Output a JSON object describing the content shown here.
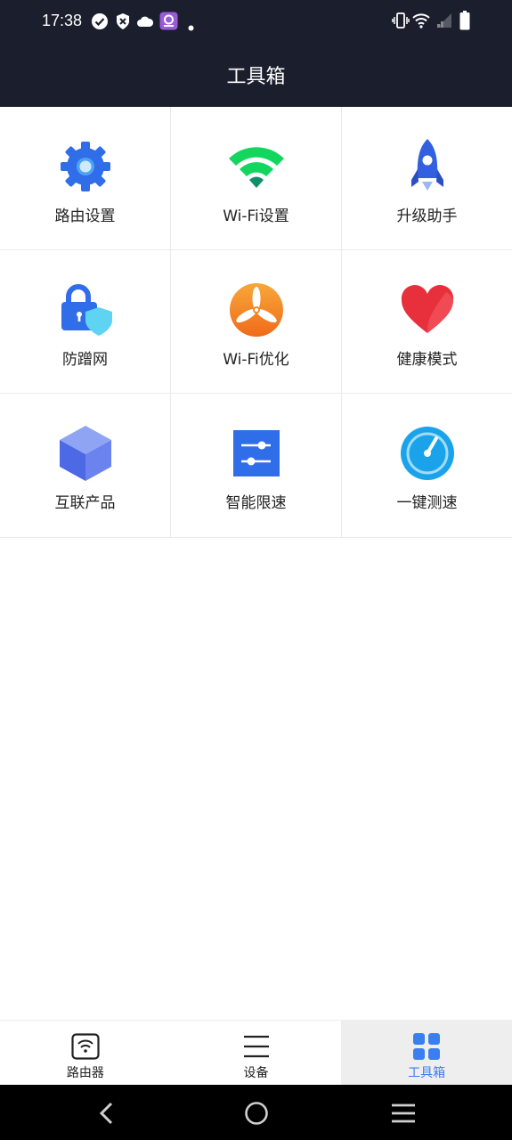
{
  "status_bar": {
    "time": "17:38",
    "icons": [
      "check-circle-icon",
      "shield-x-icon",
      "cloud-icon",
      "app-badge-icon",
      "dot-icon",
      "vibrate-icon",
      "wifi-icon",
      "signal-icon",
      "battery-icon"
    ]
  },
  "header": {
    "title": "工具箱"
  },
  "tools": [
    {
      "label": "路由设置",
      "icon": "gear-icon"
    },
    {
      "label": "Wi-Fi设置",
      "icon": "wifi-icon"
    },
    {
      "label": "升级助手",
      "icon": "rocket-icon"
    },
    {
      "label": "防蹭网",
      "icon": "lock-shield-icon"
    },
    {
      "label": "Wi-Fi优化",
      "icon": "fan-icon"
    },
    {
      "label": "健康模式",
      "icon": "heart-icon"
    },
    {
      "label": "互联产品",
      "icon": "cube-icon"
    },
    {
      "label": "智能限速",
      "icon": "sliders-icon"
    },
    {
      "label": "一键测速",
      "icon": "speedometer-icon"
    }
  ],
  "bottom_nav": [
    {
      "label": "路由器",
      "icon": "router-icon",
      "active": false
    },
    {
      "label": "设备",
      "icon": "menu-lines-icon",
      "active": false
    },
    {
      "label": "工具箱",
      "icon": "grid-icon",
      "active": true
    }
  ],
  "colors": {
    "header_bg": "#1b1f2d",
    "accent": "#3b7ef0",
    "active_tab_bg": "#eeeeee"
  },
  "system_nav": [
    "back-icon",
    "home-icon",
    "recents-icon"
  ]
}
